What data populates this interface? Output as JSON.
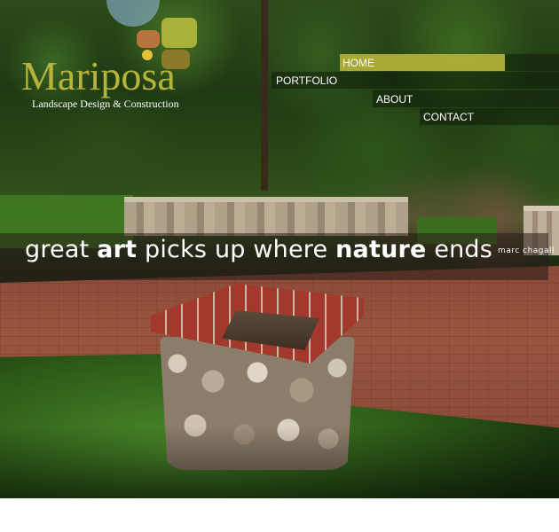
{
  "brand": {
    "name": "Mariposa",
    "tagline": "Landscape Design & Construction",
    "colors": {
      "wing_orange": "#b8743c",
      "wing_green": "#a8b23a",
      "wing_olive": "#8a7a2a",
      "wing_yellow": "#e6c23a"
    }
  },
  "nav": {
    "items": [
      {
        "label": "HOME",
        "active": true
      },
      {
        "label": "PORTFOLIO",
        "active": false
      },
      {
        "label": "ABOUT",
        "active": false
      },
      {
        "label": "CONTACT",
        "active": false
      }
    ],
    "active_color": "#b9b63a"
  },
  "hero": {
    "quote_parts": [
      "great ",
      "art",
      " picks up where ",
      "nature",
      " ends"
    ],
    "attribution": "marc chagall"
  }
}
